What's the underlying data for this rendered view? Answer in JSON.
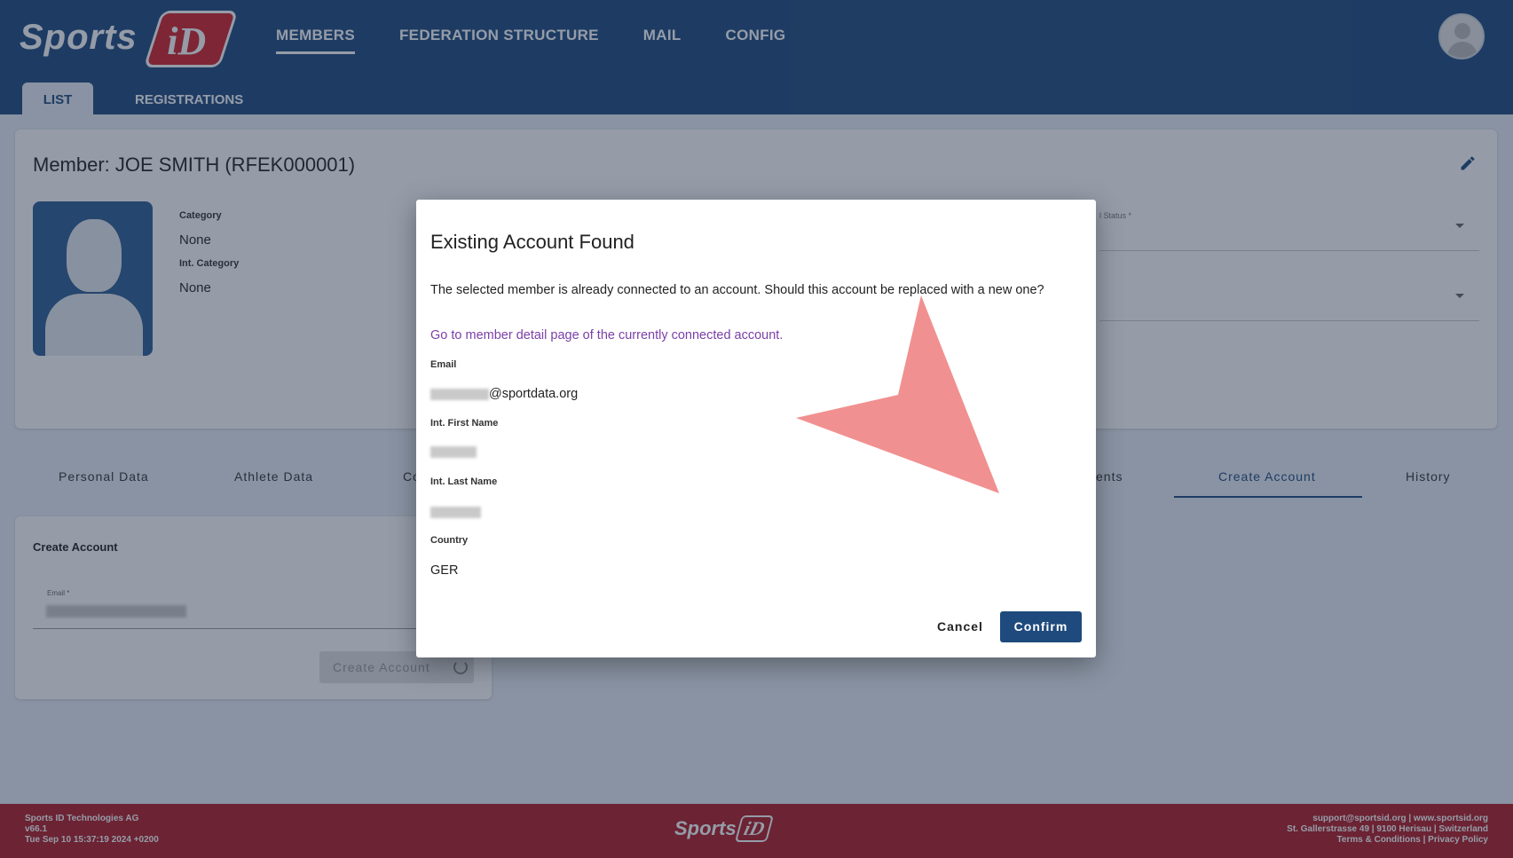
{
  "header": {
    "logo_text": "Sports",
    "logo_badge": "iD",
    "nav": [
      "MEMBERS",
      "FEDERATION STRUCTURE",
      "MAIL",
      "CONFIG"
    ],
    "subtabs": [
      "LIST",
      "REGISTRATIONS"
    ]
  },
  "member": {
    "title": "Member: JOE SMITH (RFEK000001)",
    "category_label": "Category",
    "category_value": "None",
    "int_category_label": "Int. Category",
    "int_category_value": "None",
    "status_label": "l Status *"
  },
  "detail_tabs": [
    "Personal Data",
    "Athlete Data",
    "Co",
    "ents",
    "Create Account",
    "History"
  ],
  "create_account": {
    "title": "Create Account",
    "email_label": "Email *",
    "button_label": "Create Account"
  },
  "modal": {
    "title": "Existing Account Found",
    "message": "The selected member is already connected to an account. Should this account be replaced with a new one?",
    "link": "Go to member detail page of the currently connected account.",
    "email_label": "Email",
    "email_suffix": "@sportdata.org",
    "first_name_label": "Int. First Name",
    "last_name_label": "Int. Last Name",
    "country_label": "Country",
    "country_value": "GER",
    "cancel_label": "Cancel",
    "confirm_label": "Confirm"
  },
  "footer": {
    "company": "Sports ID Technologies AG",
    "version": "v66.1",
    "build_date": "Tue Sep 10 15:37:19 2024 +0200",
    "contact": "support@sportsid.org | www.sportsid.org",
    "address": "St. Gallerstrasse 49 | 9100 Herisau | Switzerland",
    "links": "Terms & Conditions | Privacy Policy",
    "logo_text": "Sports",
    "logo_badge": "iD"
  },
  "colors": {
    "primary": "#1f4a7d",
    "footer": "#b11c22",
    "link": "#7b3fa8",
    "annotation_arrow": "#f08a8a"
  }
}
